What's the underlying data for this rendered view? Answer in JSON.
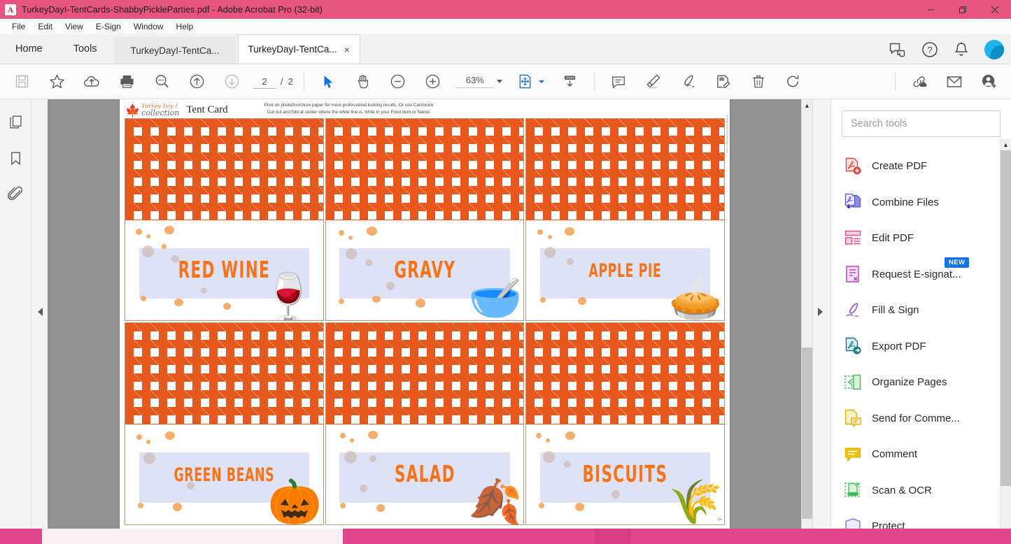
{
  "window": {
    "title": "TurkeyDayI-TentCards-ShabbyPickleParties.pdf - Adobe Acrobat Pro (32-bit)",
    "titlebar_color": "#E75480",
    "minimize_label": "−",
    "restore_label": "❐",
    "close_label": "✕"
  },
  "menubar": {
    "items": [
      {
        "label": "File"
      },
      {
        "label": "Edit"
      },
      {
        "label": "View"
      },
      {
        "label": "E-Sign"
      },
      {
        "label": "Window"
      },
      {
        "label": "Help"
      }
    ]
  },
  "tabbar": {
    "home_label": "Home",
    "tools_label": "Tools",
    "doc_tab_1": "TurkeyDayI-TentCa...",
    "doc_tab_2": "TurkeyDayI-TentCa...",
    "close_glyph": "×",
    "right_icons": [
      {
        "name": "feedback-icon"
      },
      {
        "name": "help-icon"
      },
      {
        "name": "bell-icon"
      },
      {
        "name": "avatar"
      }
    ]
  },
  "toolbar": {
    "save_label": "Save",
    "star_label": "Add to favorites",
    "upload_label": "Save to cloud",
    "print_label": "Print file",
    "search_label": "Find text",
    "prev_page_label": "Previous page",
    "next_page_label": "Next page",
    "page_current": "2",
    "page_separator": "/",
    "page_total": "2",
    "select_label": "Select tool",
    "hand_label": "Hand tool",
    "zoom_out_label": "Zoom out",
    "zoom_in_label": "Zoom in",
    "zoom_value": "63%",
    "fit_label": "Fit page",
    "scroll_label": "Scrolling mode",
    "comment_label": "Add comment",
    "highlight_label": "Highlight text",
    "sign_label": "Sign",
    "request_sign_label": "Request signature",
    "delete_label": "Delete pages",
    "rotate_label": "Rotate page",
    "share_link_label": "Share link",
    "email_label": "Send by email",
    "add_person_label": "Invite people"
  },
  "leftrail": {
    "items": [
      {
        "name": "page-thumbnails-icon",
        "label": "Page thumbnails"
      },
      {
        "name": "bookmarks-icon",
        "label": "Bookmarks"
      },
      {
        "name": "attachments-icon",
        "label": "Attachments"
      }
    ],
    "collapse_label": "◀"
  },
  "toolspanel": {
    "search_placeholder": "Search tools",
    "search_value": "",
    "items": [
      {
        "label": "Create PDF",
        "icon": "create-pdf-icon",
        "color": "#E8453C",
        "badge": ""
      },
      {
        "label": "Combine Files",
        "icon": "combine-files-icon",
        "color": "#5A55D8",
        "badge": ""
      },
      {
        "label": "Edit PDF",
        "icon": "edit-pdf-icon",
        "color": "#E8468E",
        "badge": ""
      },
      {
        "label": "Request E-signat...",
        "icon": "request-esign-icon",
        "color": "#B43CC4",
        "badge": "NEW"
      },
      {
        "label": "Fill & Sign",
        "icon": "fill-sign-icon",
        "color": "#8C4BE0",
        "badge": ""
      },
      {
        "label": "Export PDF",
        "icon": "export-pdf-icon",
        "color": "#0F7B8A",
        "badge": ""
      },
      {
        "label": "Organize Pages",
        "icon": "organize-pages-icon",
        "color": "#3EBA57",
        "badge": ""
      },
      {
        "label": "Send for Comme...",
        "icon": "send-comments-icon",
        "color": "#E3B209",
        "badge": ""
      },
      {
        "label": "Comment",
        "icon": "comment-icon",
        "color": "#E3B209",
        "badge": ""
      },
      {
        "label": "Scan & OCR",
        "icon": "scan-ocr-icon",
        "color": "#3EBA57",
        "badge": ""
      },
      {
        "label": "Protect",
        "icon": "protect-icon",
        "color": "#8C7BE0",
        "badge": ""
      }
    ]
  },
  "document": {
    "brand_top": "Turkey Day I",
    "brand_bottom": "collection",
    "title": "Tent Card",
    "instruction_line_1": "Print on photo/brochure paper for more professional looking results. Or use Cardstock",
    "instruction_line_2": "Cut out and fold at center where the white line is. Write in your Food Item or Name.",
    "side_stamp": "ShabbyPickleParties.com",
    "pattern_color": "#E8581C",
    "band_color": "#DDE2F7",
    "text_color": "#F97316",
    "border_color": "#B99A78",
    "cards": [
      {
        "label": "RED WINE",
        "art": "🍷",
        "art_name": "wine-glass-art"
      },
      {
        "label": "GRAVY",
        "art": "🥣",
        "art_name": "gravy-boat-art"
      },
      {
        "label": "APPLE PIE",
        "art": "🥧",
        "art_name": "apple-pie-art"
      },
      {
        "label": "GREEN BEANS",
        "art": "🎃",
        "art_name": "pumpkin-art"
      },
      {
        "label": "SALAD",
        "art": "🍂",
        "art_name": "oak-leaf-art"
      },
      {
        "label": "BISCUITS",
        "art": "🌾",
        "art_name": "dry-leaf-art"
      }
    ]
  },
  "taskbar": {
    "color": "#E2458C"
  }
}
